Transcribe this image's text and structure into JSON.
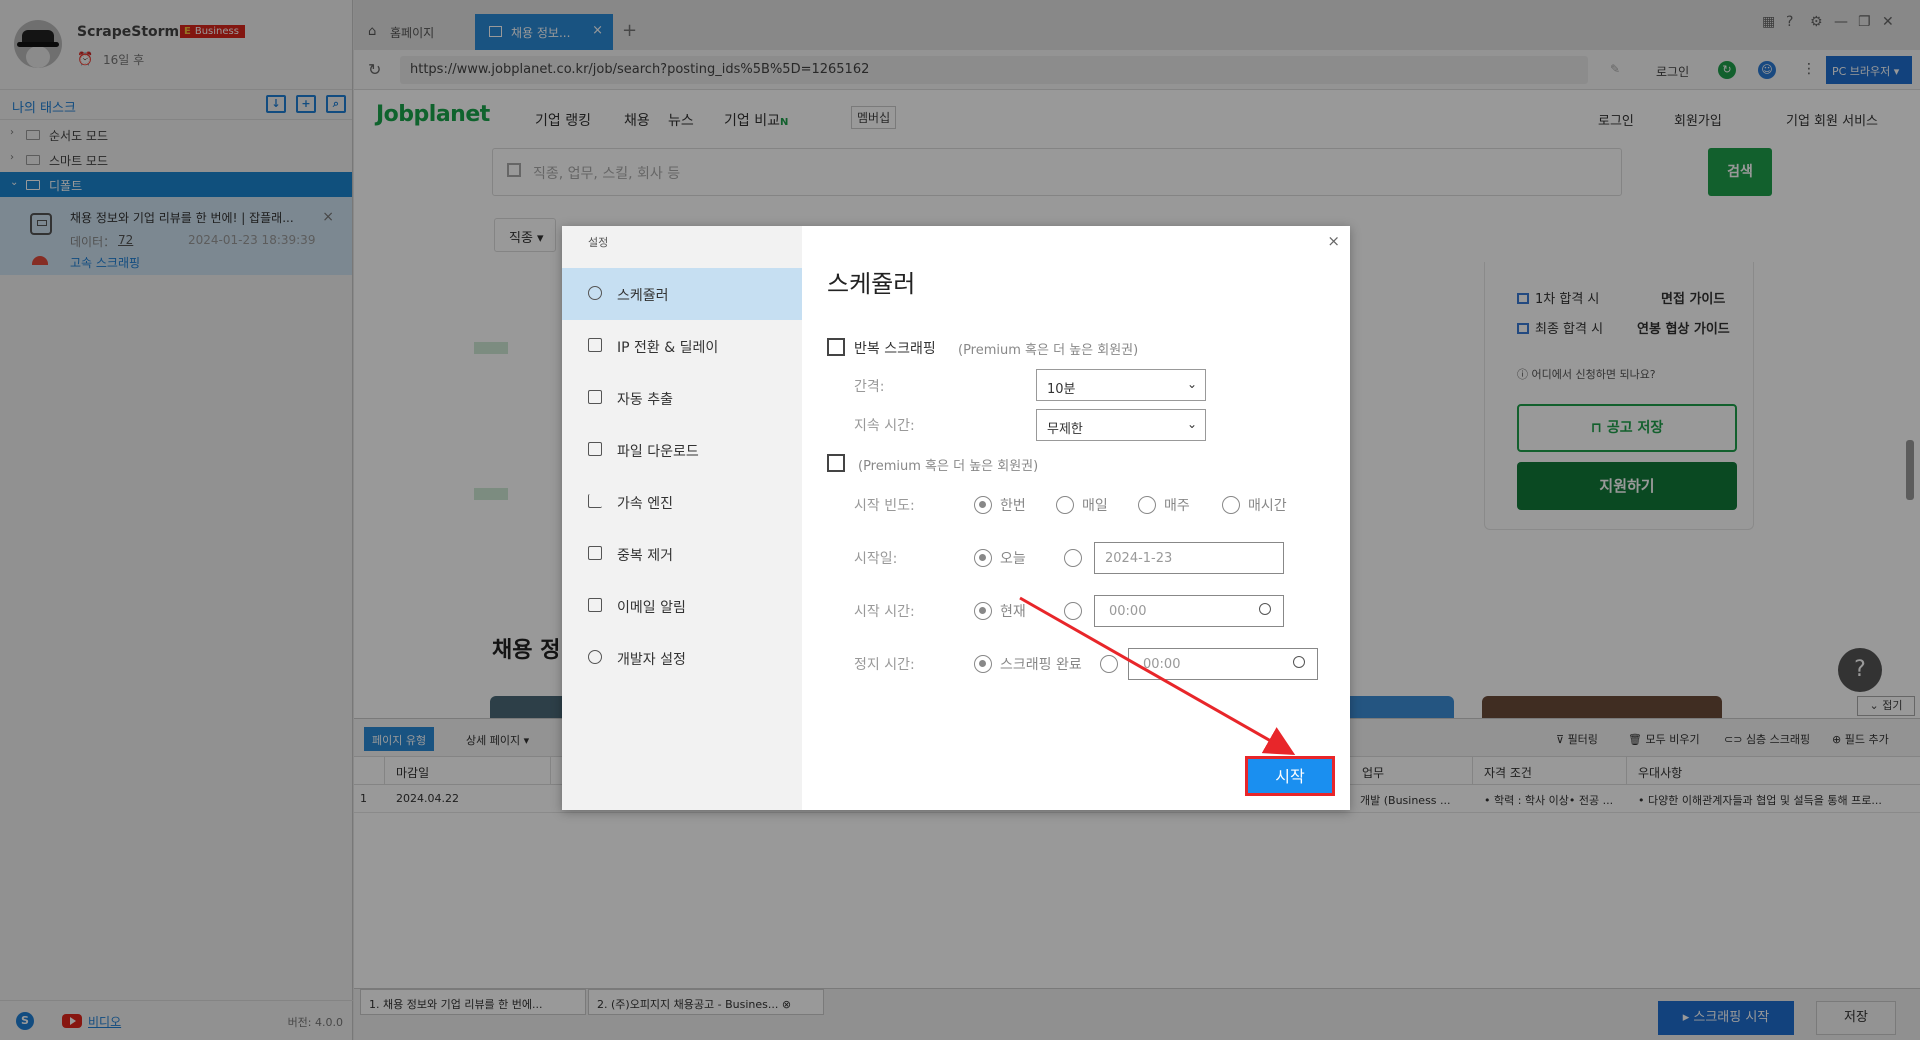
{
  "sidebar": {
    "app_name": "ScrapeStorm",
    "plan_letter": "E",
    "plan": "Business",
    "days_left": "16일 후",
    "tasks_title": "나의 태스크",
    "tree": [
      "순서도 모드",
      "스마트 모드",
      "디폴트"
    ],
    "task": {
      "name": "채용 정보와 기업 리뷰를 한 번에! | 잡플래...",
      "data_label": "데이터：",
      "data_count": "72",
      "date": "2024-01-23 18:39:39",
      "speed": "고속 스크래핑"
    },
    "video_link": "비디오",
    "version": "버전: 4.0.0"
  },
  "browser": {
    "tabs": [
      "홈페이지",
      "채용 정보..."
    ],
    "url": "https://www.jobplanet.co.kr/job/search?posting_ids%5B%5D=1265162",
    "login": "로그인",
    "pc_browser": "PC 브라우저"
  },
  "site": {
    "logo": "Jobplanet",
    "nav": [
      "기업 랭킹",
      "채용",
      "뉴스",
      "기업 비교"
    ],
    "nav_new": "N",
    "membership": "멤버십",
    "right_nav": [
      "로그인",
      "회원가입",
      "기업 회원 서비스"
    ],
    "search_placeholder": "직종, 업무, 스킬, 회사 등",
    "search_btn": "검색",
    "filter_chip": "직종",
    "panel": {
      "item1": "1차 합격 시",
      "guide1": "면접 가이드",
      "item2": "최종 합격 시",
      "guide2": "연봉 협상 가이드",
      "where": "어디에서 신청하면 되나요?",
      "save": "공고 저장",
      "apply": "지원하기"
    },
    "heading": "채용 정",
    "collapse": "접기"
  },
  "data_table": {
    "page_type_label": "페이지 유형",
    "page_type_value": "상세 페이지",
    "actions": [
      "필터링",
      "모두 비우기",
      "심층 스크래핑",
      "필드 추가"
    ],
    "headers": [
      "마감일",
      "업무",
      "자격 조건",
      "우대사항"
    ],
    "row": {
      "index": "1",
      "deadline": "2024.04.22",
      "task": "개발 (Business ...",
      "qualification": "• 학력 : 학사 이상• 전공 ...",
      "preference": "• 다양한 이해관계자들과 협업 및 설득을 통해 프로..."
    }
  },
  "bottom": {
    "tabs": [
      "1. 채용 정보와 기업 리뷰를 한 번에...",
      "2. (주)오피지지 채용공고 - Busines..."
    ],
    "start": "스크래핑 시작",
    "save": "저장"
  },
  "modal": {
    "title": "설정",
    "nav": [
      "스케쥴러",
      "IP 전환 & 딜레이",
      "자동 추출",
      "파일 다운로드",
      "가속 엔진",
      "중복 제거",
      "이메일 알림",
      "개발자 설정"
    ],
    "heading": "스케쥴러",
    "repeat_label": "반복 스크래핑",
    "premium_note": "(Premium 혹은 더 높은 회원권)",
    "interval_label": "간격:",
    "interval_value": "10분",
    "duration_label": "지속 시간:",
    "duration_value": "무제한",
    "freq_label": "시작 빈도:",
    "freq_options": [
      "한번",
      "매일",
      "매주",
      "매시간"
    ],
    "start_date_label": "시작일:",
    "today": "오늘",
    "start_date_value": "2024-1-23",
    "start_time_label": "시작 시간:",
    "now": "현재",
    "start_time_value": "00:00",
    "stop_time_label": "정지 시간:",
    "scrape_done": "스크래핑 완료",
    "stop_time_value": "00:00",
    "start_btn": "시작"
  },
  "colors": {
    "accent_blue": "#1e7fd6",
    "jobplanet_green": "#1aa54b",
    "annotation_red": "#e8262a"
  }
}
